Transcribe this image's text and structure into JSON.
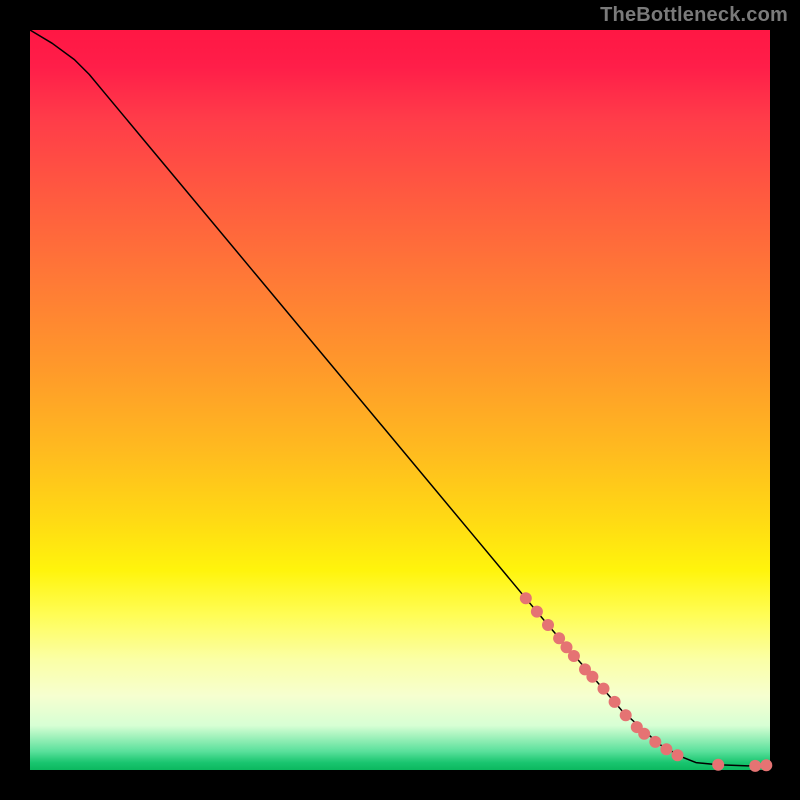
{
  "attribution": "TheBottleneck.com",
  "colors": {
    "background": "#000000",
    "point": "#e57373",
    "curve": "#000000"
  },
  "chart_data": {
    "type": "line",
    "title": "",
    "xlabel": "",
    "ylabel": "",
    "xlim": [
      0,
      100
    ],
    "ylim": [
      0,
      100
    ],
    "grid": false,
    "legend": false,
    "curve_points": [
      {
        "x": 0,
        "y": 100
      },
      {
        "x": 3,
        "y": 98.2
      },
      {
        "x": 6,
        "y": 96.0
      },
      {
        "x": 8,
        "y": 94.0
      },
      {
        "x": 10,
        "y": 91.6
      },
      {
        "x": 15,
        "y": 85.6
      },
      {
        "x": 20,
        "y": 79.6
      },
      {
        "x": 30,
        "y": 67.6
      },
      {
        "x": 40,
        "y": 55.6
      },
      {
        "x": 50,
        "y": 43.6
      },
      {
        "x": 60,
        "y": 31.6
      },
      {
        "x": 70,
        "y": 19.6
      },
      {
        "x": 80,
        "y": 8.0
      },
      {
        "x": 85,
        "y": 3.5
      },
      {
        "x": 88,
        "y": 1.8
      },
      {
        "x": 90,
        "y": 1.0
      },
      {
        "x": 93,
        "y": 0.7
      },
      {
        "x": 97,
        "y": 0.55
      },
      {
        "x": 100,
        "y": 0.7
      }
    ],
    "series": [
      {
        "name": "samples",
        "marker": "circle",
        "point_radius_px": 6,
        "points": [
          {
            "x": 67.0,
            "y": 23.2
          },
          {
            "x": 68.5,
            "y": 21.4
          },
          {
            "x": 70.0,
            "y": 19.6
          },
          {
            "x": 71.5,
            "y": 17.8
          },
          {
            "x": 72.5,
            "y": 16.6
          },
          {
            "x": 73.5,
            "y": 15.4
          },
          {
            "x": 75.0,
            "y": 13.6
          },
          {
            "x": 76.0,
            "y": 12.6
          },
          {
            "x": 77.5,
            "y": 11.0
          },
          {
            "x": 79.0,
            "y": 9.2
          },
          {
            "x": 80.5,
            "y": 7.4
          },
          {
            "x": 82.0,
            "y": 5.8
          },
          {
            "x": 83.0,
            "y": 4.9
          },
          {
            "x": 84.5,
            "y": 3.8
          },
          {
            "x": 86.0,
            "y": 2.8
          },
          {
            "x": 87.5,
            "y": 2.0
          },
          {
            "x": 93.0,
            "y": 0.7
          },
          {
            "x": 98.0,
            "y": 0.55
          },
          {
            "x": 99.5,
            "y": 0.65
          }
        ]
      }
    ]
  }
}
